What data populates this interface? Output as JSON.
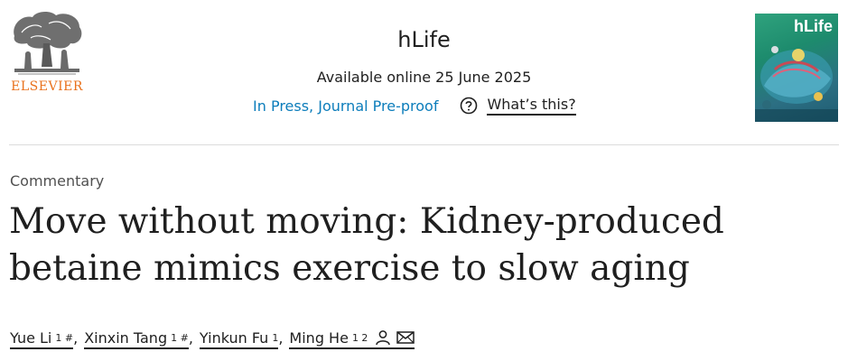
{
  "publisher": {
    "name": "ELSEVIER",
    "brand_color": "#e9711c"
  },
  "journal": {
    "title": "hLife",
    "availability": "Available online 25 June 2025",
    "status": "In Press, Journal Pre-proof",
    "help_label": "What’s this?",
    "cover_title": "hLife",
    "link_color": "#0c7dbb"
  },
  "article": {
    "type": "Commentary",
    "title_line1": "Move without moving: Kidney-produced",
    "title_line2": "betaine mimics exercise to slow aging",
    "authors": [
      {
        "name": "Yue Li",
        "sup": "1 #"
      },
      {
        "name": "Xinxin Tang",
        "sup": "1 #"
      },
      {
        "name": "Yinkun Fu",
        "sup": "1"
      },
      {
        "name": "Ming He",
        "sup": "1 2"
      }
    ],
    "author_separator": ",",
    "icons": [
      "person-icon",
      "envelope-icon"
    ]
  }
}
